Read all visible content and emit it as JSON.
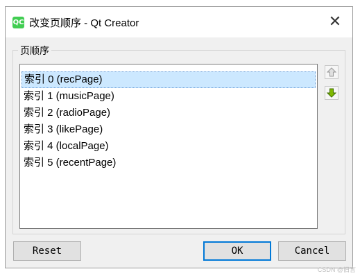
{
  "window": {
    "title": "改变页顺序 - Qt Creator",
    "app_icon": "QC",
    "close_glyph": "✕"
  },
  "group": {
    "title": "页顺序"
  },
  "list": {
    "items": [
      "索引 0 (recPage)",
      "索引 1 (musicPage)",
      "索引 2 (radioPage)",
      "索引 3 (likePage)",
      "索引 4 (localPage)",
      "索引 5 (recentPage)"
    ],
    "selected_index": 0
  },
  "side_buttons": {
    "up_icon": "arrow-up-icon",
    "down_icon": "arrow-down-icon"
  },
  "buttons": {
    "reset": "Reset",
    "ok": "OK",
    "cancel": "Cancel"
  },
  "watermark": "CSDN @旧言",
  "colors": {
    "selection": "#cce8ff",
    "default_button_border": "#0078d7",
    "qt_green": "#41cd52"
  }
}
